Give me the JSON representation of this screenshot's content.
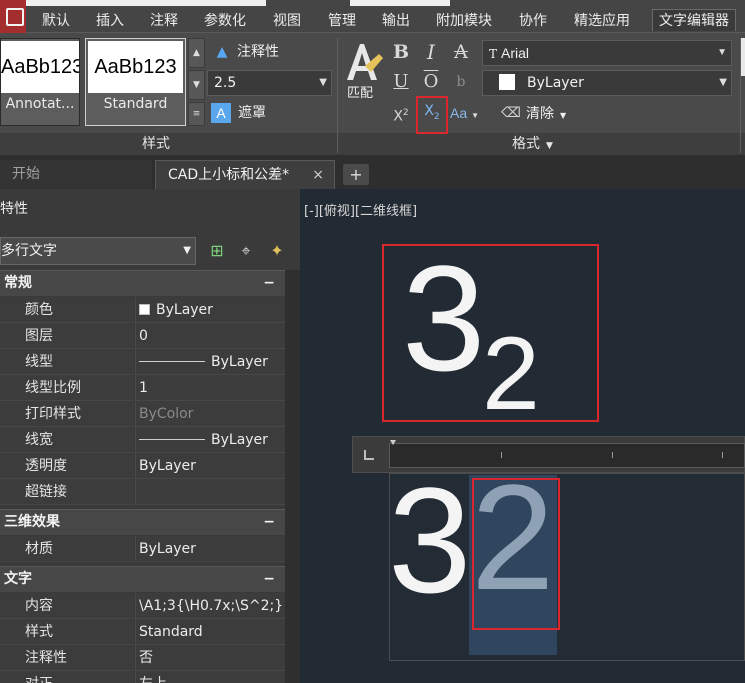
{
  "ribbon": {
    "tabs": [
      "默认",
      "插入",
      "注释",
      "参数化",
      "视图",
      "管理",
      "输出",
      "附加模块",
      "协作",
      "精选应用",
      "文字编辑器"
    ],
    "active_tab": "文字编辑器",
    "style_panel": {
      "title": "样式",
      "styles": [
        {
          "sample": "AaBb123",
          "name": "Annotat..."
        },
        {
          "sample": "AaBb123",
          "name": "Standard"
        }
      ],
      "annotative_label": "注释性",
      "text_height": "2.5",
      "mask_label": "遮罩"
    },
    "format_panel": {
      "title": "格式",
      "match_label": "匹配",
      "bold": "B",
      "italic": "I",
      "strike": "A",
      "underline": "U",
      "overline": "O",
      "stack": "b",
      "superscript": "X",
      "superscript_mark": "2",
      "subscript": "X",
      "subscript_mark": "2",
      "case_label": "Aa",
      "font": "Arial",
      "color": "ByLayer",
      "clear_label": "清除"
    }
  },
  "doc_tabs": {
    "start": "开始",
    "drawing": "CAD上小标和公差*",
    "close": "×",
    "add": "+"
  },
  "properties": {
    "title": "特性",
    "object_type": "多行文字",
    "categories": {
      "general": "常规",
      "three_d": "三维效果",
      "text": "文字"
    },
    "general_rows": [
      {
        "key": "颜色",
        "value": "ByLayer"
      },
      {
        "key": "图层",
        "value": "0"
      },
      {
        "key": "线型",
        "value": "ByLayer"
      },
      {
        "key": "线型比例",
        "value": "1"
      },
      {
        "key": "打印样式",
        "value": "ByColor"
      },
      {
        "key": "线宽",
        "value": "ByLayer"
      },
      {
        "key": "透明度",
        "value": "ByLayer"
      },
      {
        "key": "超链接",
        "value": ""
      }
    ],
    "three_d_rows": [
      {
        "key": "材质",
        "value": "ByLayer"
      }
    ],
    "text_rows": [
      {
        "key": "内容",
        "value": "\\A1;3{\\H0.7x;\\S^2;}"
      },
      {
        "key": "样式",
        "value": "Standard"
      },
      {
        "key": "注释性",
        "value": "否"
      },
      {
        "key": "对正",
        "value": "左上"
      }
    ]
  },
  "canvas": {
    "view_label": "[-][俯视][二维线框]",
    "rendered_base": "3",
    "rendered_sub": "2",
    "edit_base": "3",
    "edit_sub": "2"
  },
  "colors": {
    "highlight_frame": "#d9272d",
    "canvas_bg": "#222a33",
    "selection_bg": "#2f465e"
  }
}
